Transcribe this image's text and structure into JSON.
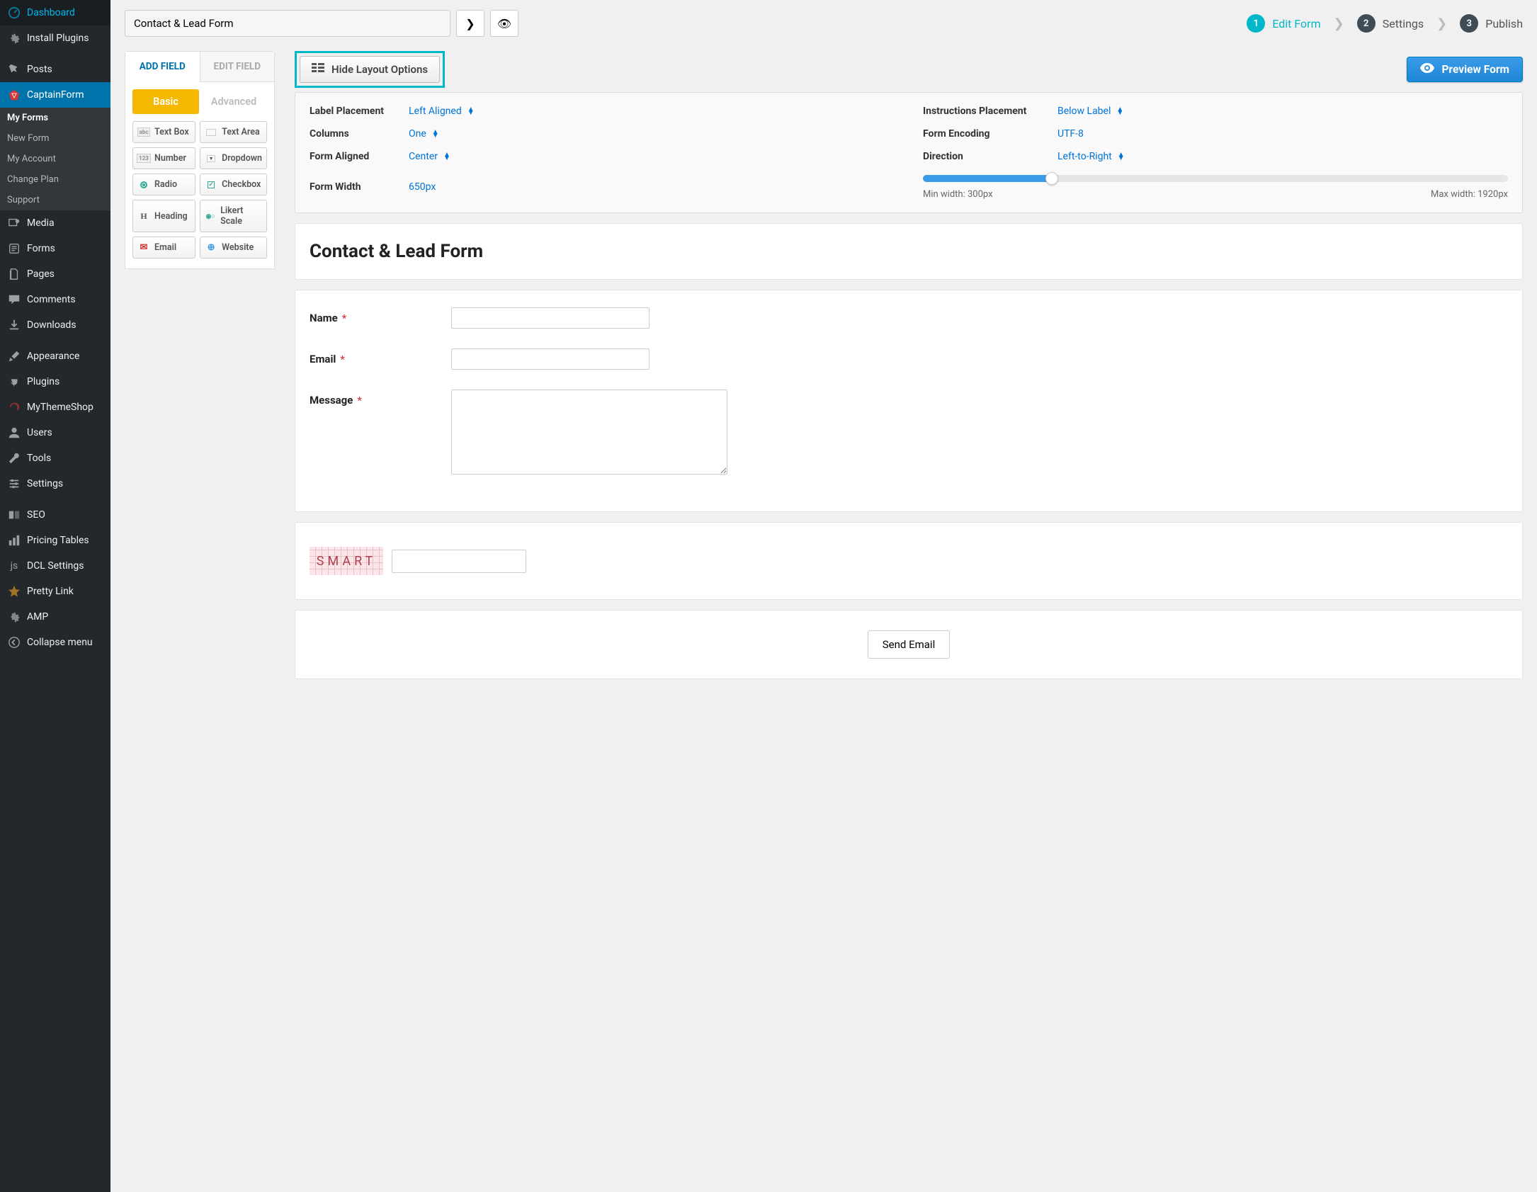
{
  "sidebar": {
    "items": [
      {
        "icon": "dashboard",
        "label": "Dashboard"
      },
      {
        "icon": "gear",
        "label": "Install Plugins"
      },
      {
        "gap": true
      },
      {
        "icon": "pin",
        "label": "Posts"
      },
      {
        "icon": "captain",
        "label": "CaptainForm",
        "active": true,
        "sub": [
          {
            "label": "My Forms",
            "active": true
          },
          {
            "label": "New Form"
          },
          {
            "label": "My Account"
          },
          {
            "label": "Change Plan"
          },
          {
            "label": "Support"
          }
        ]
      },
      {
        "icon": "media",
        "label": "Media"
      },
      {
        "icon": "forms",
        "label": "Forms"
      },
      {
        "icon": "pages",
        "label": "Pages"
      },
      {
        "icon": "comment",
        "label": "Comments"
      },
      {
        "icon": "download",
        "label": "Downloads"
      },
      {
        "gap": true
      },
      {
        "icon": "brush",
        "label": "Appearance"
      },
      {
        "icon": "plug",
        "label": "Plugins"
      },
      {
        "icon": "refresh",
        "label": "MyThemeShop"
      },
      {
        "icon": "user",
        "label": "Users"
      },
      {
        "icon": "wrench",
        "label": "Tools"
      },
      {
        "icon": "sliders",
        "label": "Settings"
      },
      {
        "gap": true
      },
      {
        "icon": "seo",
        "label": "SEO"
      },
      {
        "icon": "bars",
        "label": "Pricing Tables"
      },
      {
        "icon": "js",
        "label": "DCL Settings"
      },
      {
        "icon": "star",
        "label": "Pretty Link"
      },
      {
        "icon": "gear",
        "label": "AMP"
      },
      {
        "icon": "collapse",
        "label": "Collapse menu"
      }
    ]
  },
  "topbar": {
    "title": "Contact & Lead Form",
    "steps": [
      {
        "num": "1",
        "label": "Edit Form",
        "active": true
      },
      {
        "num": "2",
        "label": "Settings"
      },
      {
        "num": "3",
        "label": "Publish"
      }
    ]
  },
  "left_panel": {
    "tabs": [
      {
        "label": "ADD FIELD",
        "active": true
      },
      {
        "label": "EDIT FIELD"
      }
    ],
    "subtabs": [
      {
        "label": "Basic",
        "active": true
      },
      {
        "label": "Advanced"
      }
    ],
    "fields": [
      {
        "icon": "abc",
        "label": "Text Box"
      },
      {
        "icon": "area",
        "label": "Text Area"
      },
      {
        "icon": "123",
        "label": "Number"
      },
      {
        "icon": "dd",
        "label": "Dropdown"
      },
      {
        "icon": "radio",
        "label": "Radio"
      },
      {
        "icon": "check",
        "label": "Checkbox"
      },
      {
        "icon": "H",
        "label": "Heading"
      },
      {
        "icon": "likert",
        "label": "Likert Scale"
      },
      {
        "icon": "mail",
        "label": "Email"
      },
      {
        "icon": "globe",
        "label": "Website"
      }
    ]
  },
  "toolbar": {
    "hide_label": "Hide Layout Options",
    "preview_label": "Preview Form"
  },
  "layout": {
    "label_placement": {
      "label": "Label Placement",
      "value": "Left Aligned"
    },
    "columns": {
      "label": "Columns",
      "value": "One"
    },
    "form_aligned": {
      "label": "Form Aligned",
      "value": "Center"
    },
    "form_width": {
      "label": "Form Width",
      "value": "650px"
    },
    "instructions": {
      "label": "Instructions Placement",
      "value": "Below Label"
    },
    "encoding": {
      "label": "Form Encoding",
      "value": "UTF-8"
    },
    "direction": {
      "label": "Direction",
      "value": "Left-to-Right"
    },
    "min_width": "Min width: 300px",
    "max_width": "Max width: 1920px"
  },
  "form": {
    "title": "Contact & Lead Form",
    "fields": [
      {
        "label": "Name",
        "required": true,
        "type": "text"
      },
      {
        "label": "Email",
        "required": true,
        "type": "text"
      },
      {
        "label": "Message",
        "required": true,
        "type": "textarea"
      }
    ],
    "captcha_text": "SMART",
    "submit": "Send Email"
  }
}
